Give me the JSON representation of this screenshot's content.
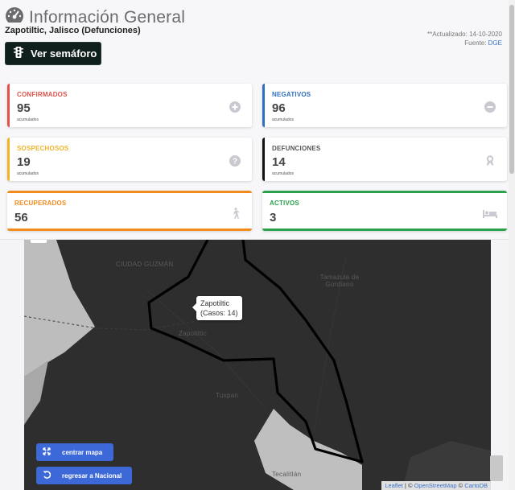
{
  "header": {
    "title": "Información General",
    "subtitle": "Zapotiltic, Jalisco (Defunciones)",
    "updated": "**Actualizado: 14-10-2020",
    "source_prefix": "Fuente: ",
    "source_link": "DGE",
    "semaforo_label": "Ver semáforo"
  },
  "cards": {
    "confirmados": {
      "label": "CONFIRMADOS",
      "value": "95",
      "note": "acumulados",
      "color": "#e0524a",
      "icon": "plus-circle-icon"
    },
    "negativos": {
      "label": "NEGATIVOS",
      "value": "96",
      "note": "acumulados",
      "color": "#2f6fbf",
      "icon": "minus-circle-icon"
    },
    "sospechosos": {
      "label": "SOSPECHOSOS",
      "value": "19",
      "note": "acumulados",
      "color": "#f0b429",
      "icon": "question-circle-icon"
    },
    "defunciones": {
      "label": "DEFUNCIONES",
      "value": "14",
      "note": "acumulados",
      "color": "#111111",
      "icon": "ribbon-icon"
    },
    "recuperados": {
      "label": "RECUPERADOS",
      "value": "56",
      "color": "#f28a1c",
      "icon": "walking-icon"
    },
    "activos": {
      "label": "ACTIVOS",
      "value": "3",
      "color": "#2aa14a",
      "icon": "bed-icon"
    }
  },
  "map": {
    "tooltip_name": "Zapotiltic",
    "tooltip_cases": "(Casos: 14)",
    "places": [
      "CIUDAD GUZMÁN",
      "Tamazula de Gordiano",
      "Zapotiltic",
      "Tuxpan",
      "Tecalitlán"
    ],
    "center_button": "centrar mapa",
    "national_button": "regresar a Nacional",
    "attribution": {
      "leaflet": "Leaflet",
      "sep": " | © ",
      "osm": "OpenStreetMap",
      "sep2": " © ",
      "carto": "CartoDB"
    }
  }
}
